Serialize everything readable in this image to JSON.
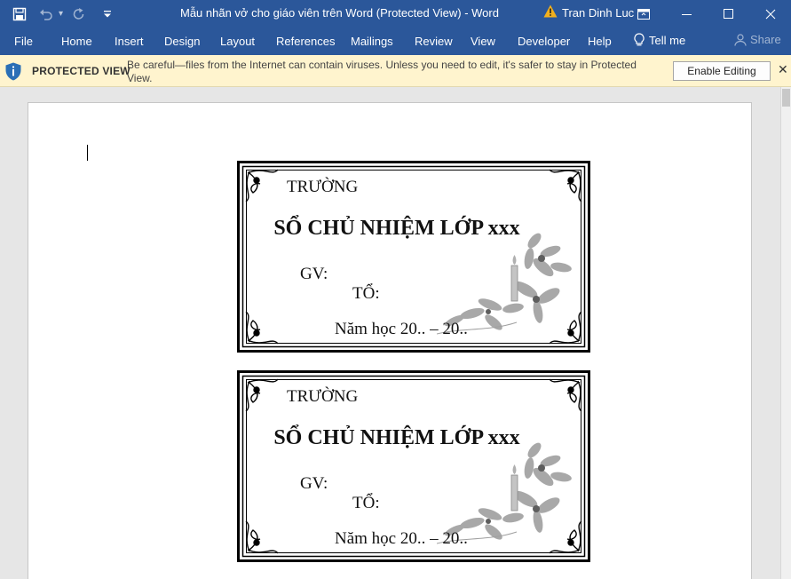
{
  "window": {
    "title": "Mẫu nhãn vở cho giáo viên trên Word (Protected View)  -  Word",
    "user": "Tran Dinh Luc"
  },
  "ribbon": {
    "tabs": [
      "File",
      "Home",
      "Insert",
      "Design",
      "Layout",
      "References",
      "Mailings",
      "Review",
      "View",
      "Developer",
      "Help"
    ],
    "tell_me": "Tell me",
    "share": "Share"
  },
  "protected_view": {
    "title": "PROTECTED VIEW",
    "message": "Be careful—files from the Internet can contain viruses. Unless you need to edit, it's safer to stay in Protected View.",
    "button": "Enable Editing"
  },
  "labels": [
    {
      "school": "TRƯỜNG",
      "heading": "SỔ CHỦ NHIỆM LỚP xxx",
      "gv": "GV:",
      "to": "TỔ:",
      "year": "Năm học 20.. – 20.."
    },
    {
      "school": "TRƯỜNG",
      "heading": "SỔ CHỦ NHIỆM LỚP xxx",
      "gv": "GV:",
      "to": "TỔ:",
      "year": "Năm học 20.. – 20.."
    }
  ],
  "colors": {
    "title_bar": "#2b579a",
    "protected_bar": "#fff4ce",
    "warning_icon": "#f2b01e",
    "shield_icon": "#2b6fb6"
  },
  "icons": [
    "save-icon",
    "undo-icon",
    "redo-icon",
    "customize-qat-icon",
    "warning-icon",
    "ribbon-display-icon",
    "minimize-icon",
    "maximize-icon",
    "close-icon",
    "lightbulb-icon",
    "share-person-icon",
    "shield-icon"
  ]
}
